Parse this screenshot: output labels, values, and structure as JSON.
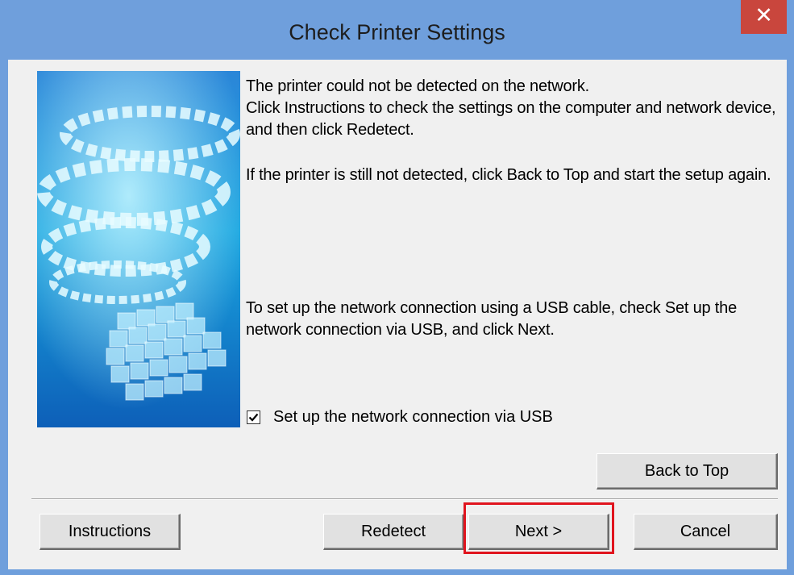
{
  "window": {
    "title": "Check Printer Settings",
    "close_glyph": "✕"
  },
  "messages": {
    "line1": "The printer could not be detected on the network.",
    "line2": "Click Instructions to check the settings on the computer and network device, and then click Redetect.",
    "paragraph2": "If the printer is still not detected, click Back to Top and start the setup again.",
    "paragraph3": "To set up the network connection using a USB cable, check Set up the network connection via USB, and click Next."
  },
  "usb_option": {
    "label": "Set up the network connection via USB",
    "checked": true
  },
  "buttons": {
    "back_to_top": "Back to Top",
    "instructions": "Instructions",
    "redetect": "Redetect",
    "next": "Next >",
    "cancel": "Cancel"
  },
  "colors": {
    "titlebar": "#6f9fdc",
    "close_button": "#c9463d",
    "highlight": "#e0141e",
    "dialog_background": "#f0f0f0"
  },
  "icons": {
    "banner": "printer-ring-graphic",
    "close": "close-icon",
    "check": "check-mark-icon"
  }
}
